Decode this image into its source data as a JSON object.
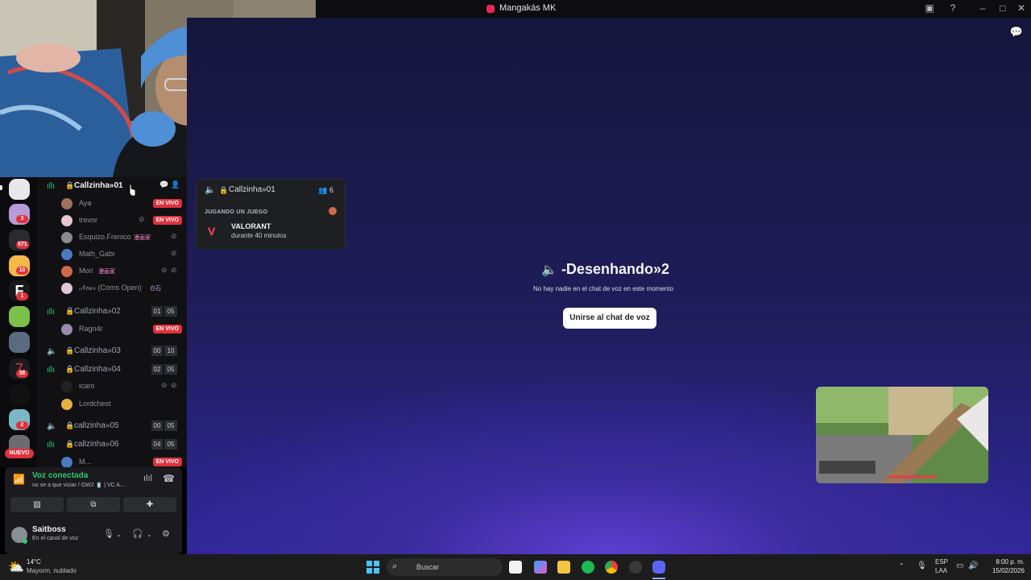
{
  "window": {
    "title": "Mangakás MK"
  },
  "server_rail": {
    "badges": [
      "3",
      "571",
      "10",
      "1",
      "38",
      "2"
    ],
    "new_label": "NUEVO"
  },
  "channels": [
    {
      "name": "Callzinha»01",
      "active": true
    },
    {
      "name": "Callzinha»02",
      "count_a": "01",
      "count_b": "05"
    },
    {
      "name": "Callzinha»03",
      "count_a": "00",
      "count_b": "10"
    },
    {
      "name": "Callzinha»04",
      "count_a": "02",
      "count_b": "05"
    },
    {
      "name": "callzinha»05",
      "count_a": "00",
      "count_b": "05"
    },
    {
      "name": "callzinha»06",
      "count_a": "04",
      "count_b": "05"
    }
  ],
  "users": {
    "ch1": [
      "Aya",
      "trevor",
      "Esquizo.Frenico",
      "Math_Gabr",
      "Mori",
      "𝒩𝑒𝒶𝓇 (Coms Open)"
    ],
    "ch2": [
      "Ragn4r"
    ],
    "ch4": [
      "icaro",
      "Lordchest"
    ],
    "ch6": [
      "M..."
    ]
  },
  "tags": {
    "manga": "漫画家",
    "near": "白石"
  },
  "live_label": "EN VIVO",
  "voice_panel": {
    "status": "Voz conectada",
    "channel": "no se a que viciar / GW2 🥤 | VC A...",
    "user_name": "Saitboss",
    "user_status": "En el canal de voz"
  },
  "popup": {
    "channel": "Callzinha»01",
    "count": "6",
    "section": "JUGANDO UN JUEGO",
    "game": "VALORANT",
    "duration": "durante 40 minutos"
  },
  "main": {
    "channel_name": "-Desenhando»2",
    "subtitle": "No hay nadie en el chat de voz en este momento",
    "join_button": "Unirse al chat de voz"
  },
  "taskbar": {
    "weather_temp": "14°C",
    "weather_desc": "Mayorm. nublado",
    "search_placeholder": "Buscar",
    "lang_top": "ESP",
    "lang_bottom": "LAA",
    "time": "8:00 p. m.",
    "date": "15/02/2026"
  },
  "colors": {
    "accent_live": "#e0323c",
    "voice_green": "#2dc770",
    "main_gradient_top": "#15163c",
    "main_gradient_bottom": "#5b3fd0"
  },
  "icons": [
    "speaker-icon",
    "voice-active-icon",
    "mic-muted-icon",
    "headset-muted-icon",
    "chat-icon",
    "search-icon",
    "settings-icon",
    "disconnect-icon",
    "windows-start-icon"
  ]
}
